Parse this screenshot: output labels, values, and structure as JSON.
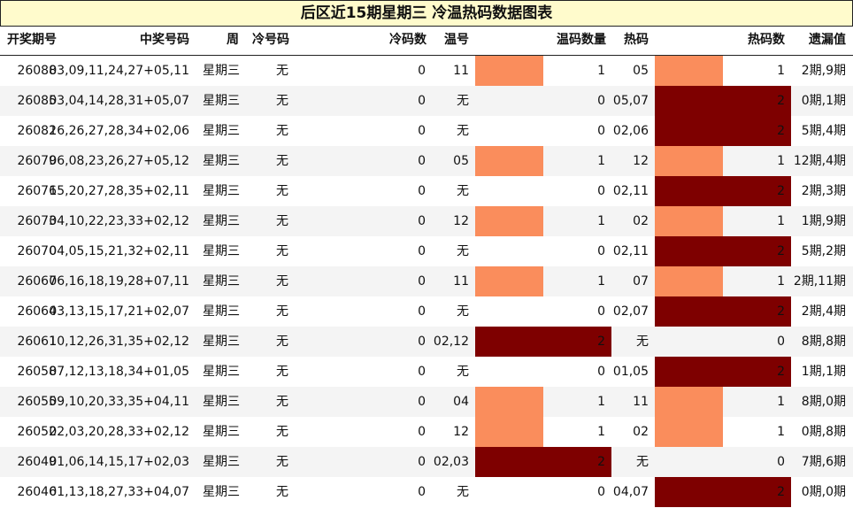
{
  "title": "后区近15期星期三 冷温热码数据图表",
  "headers": {
    "issue": "开奖期号",
    "numbers": "中奖号码",
    "weekday": "周",
    "cold_code": "冷号码",
    "cold_count": "冷码数",
    "warm_code": "温号",
    "warm_count": "温码数量",
    "hot_code": "热码",
    "hot_count": "热码数",
    "miss": "遗漏值"
  },
  "colors": {
    "one": "#fa8d5c",
    "two": "#7e0000",
    "alt_row": "#f4f4f4",
    "title_bg": "#fffbcc"
  },
  "chart_data": {
    "type": "table",
    "bar_max": 2,
    "rows": [
      {
        "issue": "26088",
        "numbers": "03,09,11,24,27+05,11",
        "weekday": "星期三",
        "cold_code": "无",
        "cold_count": 0,
        "warm_code": "11",
        "warm_count": 1,
        "hot_code": "05",
        "hot_count": 1,
        "miss": "2期,9期"
      },
      {
        "issue": "26085",
        "numbers": "03,04,14,28,31+05,07",
        "weekday": "星期三",
        "cold_code": "无",
        "cold_count": 0,
        "warm_code": "无",
        "warm_count": 0,
        "hot_code": "05,07",
        "hot_count": 2,
        "miss": "0期,1期"
      },
      {
        "issue": "26082",
        "numbers": "16,26,27,28,34+02,06",
        "weekday": "星期三",
        "cold_code": "无",
        "cold_count": 0,
        "warm_code": "无",
        "warm_count": 0,
        "hot_code": "02,06",
        "hot_count": 2,
        "miss": "5期,4期"
      },
      {
        "issue": "26079",
        "numbers": "06,08,23,26,27+05,12",
        "weekday": "星期三",
        "cold_code": "无",
        "cold_count": 0,
        "warm_code": "05",
        "warm_count": 1,
        "hot_code": "12",
        "hot_count": 1,
        "miss": "12期,4期"
      },
      {
        "issue": "26076",
        "numbers": "15,20,27,28,35+02,11",
        "weekday": "星期三",
        "cold_code": "无",
        "cold_count": 0,
        "warm_code": "无",
        "warm_count": 0,
        "hot_code": "02,11",
        "hot_count": 2,
        "miss": "2期,3期"
      },
      {
        "issue": "26073",
        "numbers": "04,10,22,23,33+02,12",
        "weekday": "星期三",
        "cold_code": "无",
        "cold_count": 0,
        "warm_code": "12",
        "warm_count": 1,
        "hot_code": "02",
        "hot_count": 1,
        "miss": "1期,9期"
      },
      {
        "issue": "26070",
        "numbers": "04,05,15,21,32+02,11",
        "weekday": "星期三",
        "cold_code": "无",
        "cold_count": 0,
        "warm_code": "无",
        "warm_count": 0,
        "hot_code": "02,11",
        "hot_count": 2,
        "miss": "5期,2期"
      },
      {
        "issue": "26067",
        "numbers": "06,16,18,19,28+07,11",
        "weekday": "星期三",
        "cold_code": "无",
        "cold_count": 0,
        "warm_code": "11",
        "warm_count": 1,
        "hot_code": "07",
        "hot_count": 1,
        "miss": "2期,11期"
      },
      {
        "issue": "26064",
        "numbers": "03,13,15,17,21+02,07",
        "weekday": "星期三",
        "cold_code": "无",
        "cold_count": 0,
        "warm_code": "无",
        "warm_count": 0,
        "hot_code": "02,07",
        "hot_count": 2,
        "miss": "2期,4期"
      },
      {
        "issue": "26061",
        "numbers": "10,12,26,31,35+02,12",
        "weekday": "星期三",
        "cold_code": "无",
        "cold_count": 0,
        "warm_code": "02,12",
        "warm_count": 2,
        "hot_code": "无",
        "hot_count": 0,
        "miss": "8期,8期"
      },
      {
        "issue": "26058",
        "numbers": "07,12,13,18,34+01,05",
        "weekday": "星期三",
        "cold_code": "无",
        "cold_count": 0,
        "warm_code": "无",
        "warm_count": 0,
        "hot_code": "01,05",
        "hot_count": 2,
        "miss": "1期,1期"
      },
      {
        "issue": "26055",
        "numbers": "09,10,20,33,35+04,11",
        "weekday": "星期三",
        "cold_code": "无",
        "cold_count": 0,
        "warm_code": "04",
        "warm_count": 1,
        "hot_code": "11",
        "hot_count": 1,
        "miss": "8期,0期"
      },
      {
        "issue": "26052",
        "numbers": "02,03,20,28,33+02,12",
        "weekday": "星期三",
        "cold_code": "无",
        "cold_count": 0,
        "warm_code": "12",
        "warm_count": 1,
        "hot_code": "02",
        "hot_count": 1,
        "miss": "0期,8期"
      },
      {
        "issue": "26049",
        "numbers": "01,06,14,15,17+02,03",
        "weekday": "星期三",
        "cold_code": "无",
        "cold_count": 0,
        "warm_code": "02,03",
        "warm_count": 2,
        "hot_code": "无",
        "hot_count": 0,
        "miss": "7期,6期"
      },
      {
        "issue": "26046",
        "numbers": "01,13,18,27,33+04,07",
        "weekday": "星期三",
        "cold_code": "无",
        "cold_count": 0,
        "warm_code": "无",
        "warm_count": 0,
        "hot_code": "04,07",
        "hot_count": 2,
        "miss": "0期,0期"
      }
    ]
  }
}
